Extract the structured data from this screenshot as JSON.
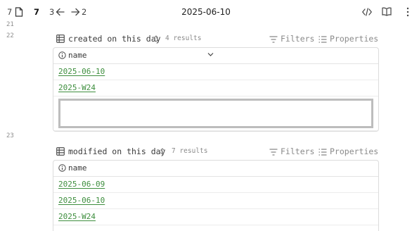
{
  "topbar": {
    "left_count": "7",
    "active_count": "7",
    "back_count": "3",
    "forward_count": "2",
    "title": "2025-06-10",
    "icons": [
      "document-icon",
      "back-arrow-icon",
      "forward-arrow-icon",
      "code-view-icon",
      "reading-view-icon",
      "more-options-icon"
    ]
  },
  "lines": {
    "l21": "21",
    "l22": "22",
    "l23": "23"
  },
  "bases": [
    {
      "view_name": "created on this day",
      "count": "4 results",
      "filters_label": "Filters",
      "properties_label": "Properties",
      "column": "name",
      "rows": [
        "2025-06-10",
        "2025-W24"
      ]
    },
    {
      "view_name": "modified on this day",
      "count": "7 results",
      "filters_label": "Filters",
      "properties_label": "Properties",
      "column": "name",
      "rows": [
        "2025-06-09",
        "2025-06-10",
        "2025-W24"
      ]
    }
  ]
}
